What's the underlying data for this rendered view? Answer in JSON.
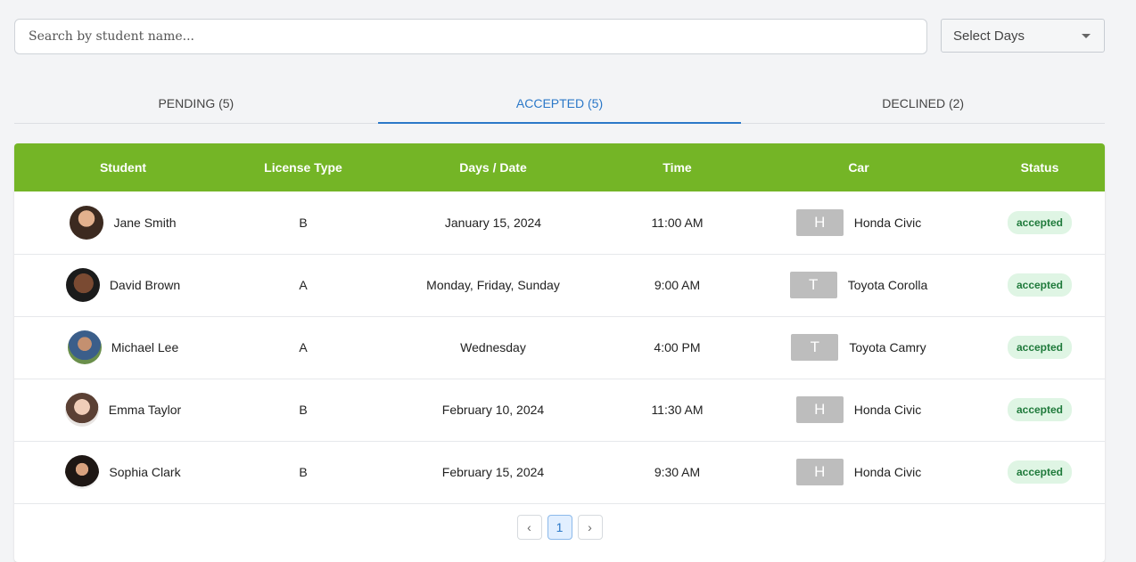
{
  "search": {
    "placeholder": "Search by student name..."
  },
  "days_select": {
    "label": "Select Days"
  },
  "tabs": [
    {
      "label": "PENDING (5)",
      "active": false
    },
    {
      "label": "ACCEPTED (5)",
      "active": true
    },
    {
      "label": "DECLINED (2)",
      "active": false
    }
  ],
  "table": {
    "headers": [
      "Student",
      "License Type",
      "Days / Date",
      "Time",
      "Car",
      "Status"
    ],
    "rows": [
      {
        "student": "Jane Smith",
        "license": "B",
        "date": "January 15, 2024",
        "time": "11:00 AM",
        "car_initial": "H",
        "car": "Honda Civic",
        "status": "accepted"
      },
      {
        "student": "David Brown",
        "license": "A",
        "date": "Monday, Friday, Sunday",
        "time": "9:00 AM",
        "car_initial": "T",
        "car": "Toyota Corolla",
        "status": "accepted"
      },
      {
        "student": "Michael Lee",
        "license": "A",
        "date": "Wednesday",
        "time": "4:00 PM",
        "car_initial": "T",
        "car": "Toyota Camry",
        "status": "accepted"
      },
      {
        "student": "Emma Taylor",
        "license": "B",
        "date": "February 10, 2024",
        "time": "11:30 AM",
        "car_initial": "H",
        "car": "Honda Civic",
        "status": "accepted"
      },
      {
        "student": "Sophia Clark",
        "license": "B",
        "date": "February 15, 2024",
        "time": "9:30 AM",
        "car_initial": "H",
        "car": "Honda Civic",
        "status": "accepted"
      }
    ]
  },
  "pagination": {
    "prev": "‹",
    "current": "1",
    "next": "›"
  },
  "colors": {
    "header_green": "#74b526",
    "accent_blue": "#2b78c8",
    "status_bg": "#dff5e4"
  }
}
